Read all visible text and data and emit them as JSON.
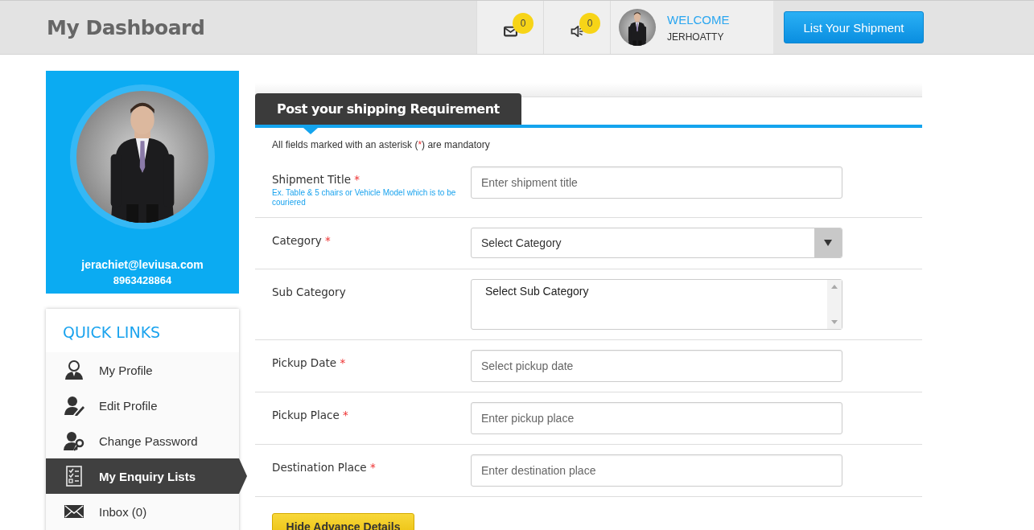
{
  "header": {
    "title": "My Dashboard",
    "notifications": [
      {
        "kind": "mail",
        "count": "0"
      },
      {
        "kind": "speaker",
        "count": "0"
      }
    ],
    "welcome": "WELCOME",
    "username": "JERHOATTY",
    "cta": "List Your Shipment"
  },
  "profile": {
    "email": "jerachiet@leviusa.com",
    "phone": "8963428864"
  },
  "quick_links": {
    "title": "QUICK LINKS",
    "items": [
      {
        "kind": "user",
        "label": "My Profile",
        "selected": false
      },
      {
        "kind": "edit",
        "label": "Edit Profile",
        "selected": false
      },
      {
        "kind": "key",
        "label": "Change Password",
        "selected": false
      },
      {
        "kind": "list",
        "label": "My Enquiry Lists",
        "selected": true
      },
      {
        "kind": "mail",
        "label": "Inbox (0)",
        "selected": false
      }
    ]
  },
  "form": {
    "tab": "Post your shipping Requirement",
    "note": {
      "before": "All fields marked with an asterisk (",
      "mark": "*",
      "after": ") are mandatory"
    },
    "fields": [
      {
        "kind": "text",
        "label": "Shipment Title",
        "marker": "*",
        "hint": "Ex. Table & 5 chairs or Vehicle Model which is to be couriered",
        "placeholder": "Enter shipment title"
      },
      {
        "kind": "select",
        "label": "Category",
        "marker": "*",
        "value": "Select Category"
      },
      {
        "kind": "listbox",
        "label": "Sub Category",
        "value": "Select Sub Category"
      },
      {
        "kind": "text",
        "label": "Pickup Date",
        "marker": "*",
        "placeholder": "Select pickup date"
      },
      {
        "kind": "text",
        "label": "Pickup Place",
        "marker": "*",
        "placeholder": "Enter pickup place"
      },
      {
        "kind": "text",
        "label": "Destination Place",
        "marker": "*",
        "placeholder": "Enter destination place"
      }
    ],
    "advance_button": "Hide Advance Details"
  }
}
